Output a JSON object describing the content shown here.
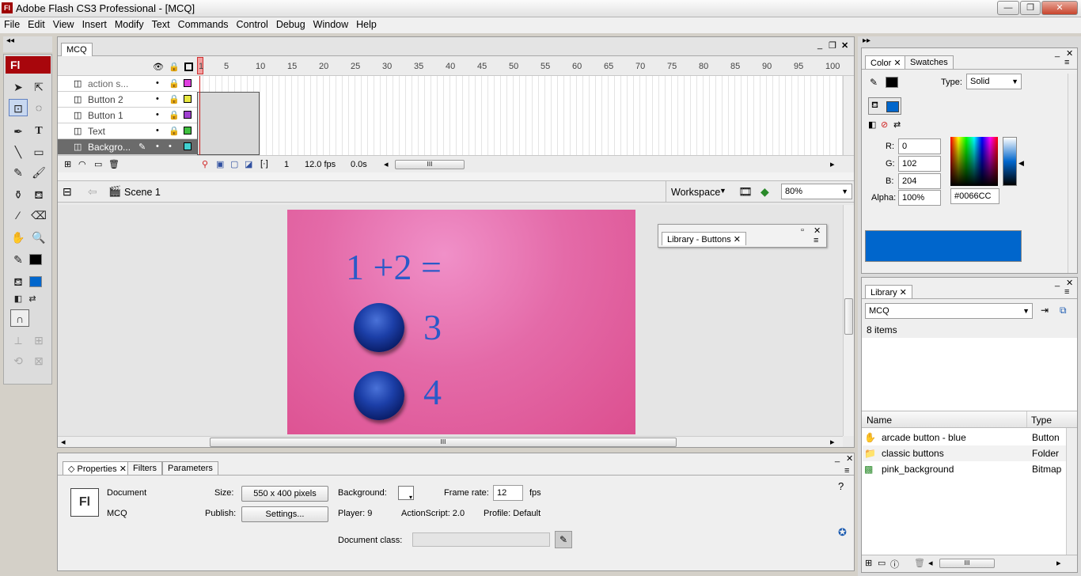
{
  "window": {
    "title": "Adobe Flash CS3 Professional - [MCQ]",
    "logo": "Fl"
  },
  "menu": [
    "File",
    "Edit",
    "View",
    "Insert",
    "Modify",
    "Text",
    "Commands",
    "Control",
    "Debug",
    "Window",
    "Help"
  ],
  "toolbox": {
    "logo": "Fl"
  },
  "document": {
    "tab": "MCQ",
    "layers": [
      {
        "name": "action s...",
        "color": "#e040e0"
      },
      {
        "name": "Button 2",
        "color": "#e8e840"
      },
      {
        "name": "Button 1",
        "color": "#a040d0"
      },
      {
        "name": "Text",
        "color": "#40c040"
      },
      {
        "name": "Backgro...",
        "color": "#40d0d0"
      }
    ],
    "frame_numbers": [
      "1",
      "5",
      "10",
      "15",
      "20",
      "25",
      "30",
      "35",
      "40",
      "45",
      "50",
      "55",
      "60",
      "65",
      "70",
      "75",
      "80",
      "85",
      "90",
      "95",
      "100"
    ],
    "status": {
      "frame": "1",
      "fps": "12.0 fps",
      "time": "0.0s"
    },
    "scene": "Scene 1",
    "workspace": "Workspace",
    "zoom": "80%"
  },
  "stage": {
    "question": "1 +2 =",
    "answer1": "3",
    "answer2": "4"
  },
  "library_buttons": {
    "title": "Library - Buttons"
  },
  "properties": {
    "tabs": [
      "Properties",
      "Filters",
      "Parameters"
    ],
    "doc_label": "Document",
    "doc_name": "MCQ",
    "size_label": "Size:",
    "size_value": "550 x 400 pixels",
    "publish_label": "Publish:",
    "publish_button": "Settings...",
    "background_label": "Background:",
    "framerate_label": "Frame rate:",
    "framerate_value": "12",
    "fps_label": "fps",
    "player": "Player:  9",
    "actionscript": "ActionScript:  2.0",
    "profile": "Profile:  Default",
    "docclass_label": "Document class:",
    "icon_text": "Fl"
  },
  "color_panel": {
    "tabs": [
      "Color",
      "Swatches"
    ],
    "type_label": "Type:",
    "type_value": "Solid",
    "r_label": "R:",
    "r": "0",
    "g_label": "G:",
    "g": "102",
    "b_label": "B:",
    "b": "204",
    "alpha_label": "Alpha:",
    "alpha": "100%",
    "hex": "#0066CC",
    "fill_color": "#0066CC"
  },
  "library": {
    "tab": "Library",
    "doc": "MCQ",
    "count": "8 items",
    "col_name": "Name",
    "col_type": "Type",
    "items": [
      {
        "name": "arcade button - blue",
        "type": "Button"
      },
      {
        "name": "classic buttons",
        "type": "Folder"
      },
      {
        "name": "pink_background",
        "type": "Bitmap"
      }
    ]
  }
}
